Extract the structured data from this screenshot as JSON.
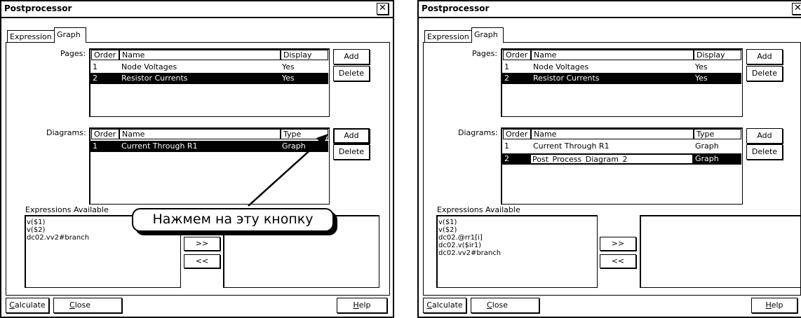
{
  "left": {
    "title": "Postprocessor",
    "close_glyph": "✕",
    "tabs": [
      "Expression",
      "Graph"
    ],
    "pages_label": "Pages:",
    "pages_headers": [
      "Order",
      "Name",
      "Display"
    ],
    "pages_rows": [
      {
        "order": "1",
        "name": "Node Voltages",
        "display": "Yes"
      },
      {
        "order": "2",
        "name": "Resistor Currents",
        "display": "Yes"
      }
    ],
    "pages_add": "Add",
    "pages_delete": "Delete",
    "diagrams_label": "Diagrams:",
    "diagrams_headers": [
      "Order",
      "Name",
      "Type"
    ],
    "diagrams_rows": [
      {
        "order": "1",
        "name": "Current Through R1",
        "type": "Graph"
      }
    ],
    "diagrams_add": "Add",
    "diagrams_delete": "Delete",
    "expressions_label": "Expressions Available",
    "expressions": [
      "v($1)",
      "v($2)",
      "dc02.vv2#branch"
    ],
    "move_right": ">>",
    "move_left": "<<",
    "calculate_u": "C",
    "calculate_rest": "alculate",
    "close_u": "C",
    "close_rest": "lose",
    "help_u": "H",
    "help_rest": "elp",
    "callout": "Нажмем на эту кнопку"
  },
  "right": {
    "title": "Postprocessor",
    "close_glyph": "✕",
    "tabs": [
      "Expression",
      "Graph"
    ],
    "pages_label": "Pages:",
    "pages_headers": [
      "Order",
      "Name",
      "Display"
    ],
    "pages_rows": [
      {
        "order": "1",
        "name": "Node Voltages",
        "display": "Yes"
      },
      {
        "order": "2",
        "name": "Resistor Currents",
        "display": "Yes"
      }
    ],
    "pages_add": "Add",
    "pages_delete": "Delete",
    "diagrams_label": "Diagrams:",
    "diagrams_headers": [
      "Order",
      "Name",
      "Type"
    ],
    "diagrams_rows": [
      {
        "order": "1",
        "name": "Current Through R1",
        "type": "Graph"
      },
      {
        "order": "2",
        "name": "Post_Process_Diagram_2",
        "type": "Graph"
      }
    ],
    "diagrams_add": "Add",
    "diagrams_delete": "Delete",
    "expressions_label": "Expressions Available",
    "expressions": [
      "v($1)",
      "v($2)",
      "dc02.@rr1[i]",
      "dc02.v($ir1)",
      "dc02.vv2#branch"
    ],
    "move_right": ">>",
    "move_left": "<<",
    "calculate_u": "C",
    "calculate_rest": "alculate",
    "close_u": "C",
    "close_rest": "lose",
    "help_u": "H",
    "help_rest": "elp"
  }
}
